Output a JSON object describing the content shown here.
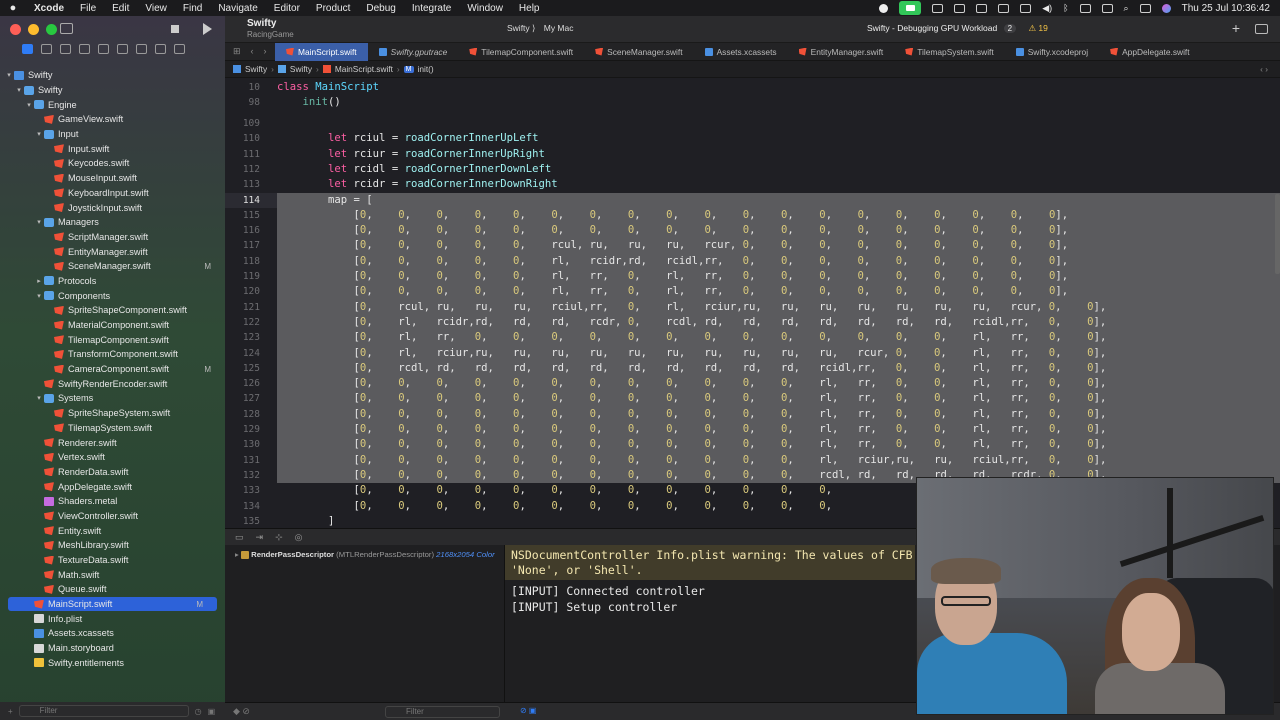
{
  "menubar": {
    "app": "Xcode",
    "items": [
      "File",
      "Edit",
      "View",
      "Find",
      "Navigate",
      "Editor",
      "Product",
      "Debug",
      "Integrate",
      "Window",
      "Help"
    ],
    "datetime": "Thu 25 Jul  10:36:42"
  },
  "toolbar": {
    "project": "Swifty",
    "subtitle": "RacingGame",
    "scheme": "Swifty ⟩",
    "destination": "My Mac",
    "status": "Swifty - Debugging GPU Workload",
    "status_count": "2",
    "warnings": "⚠ 19"
  },
  "tabs": [
    {
      "label": "MainScript.swift",
      "active": true
    },
    {
      "label": "Swifty.gputrace",
      "italic": true
    },
    {
      "label": "TilemapComponent.swift"
    },
    {
      "label": "SceneManager.swift"
    },
    {
      "label": "Assets.xcassets"
    },
    {
      "label": "EntityManager.swift"
    },
    {
      "label": "TilemapSystem.swift"
    },
    {
      "label": "Swifty.xcodeproj"
    },
    {
      "label": "AppDelegate.swift"
    }
  ],
  "jumpbar": {
    "items": [
      "Swifty",
      "Swifty",
      "MainScript.swift",
      "init()"
    ]
  },
  "navigator": {
    "items": [
      {
        "label": "Swifty",
        "depth": 0,
        "icon": "asset",
        "disc": "▾"
      },
      {
        "label": "Swifty",
        "depth": 1,
        "icon": "folder",
        "disc": "▾"
      },
      {
        "label": "Engine",
        "depth": 2,
        "icon": "folder",
        "disc": "▾"
      },
      {
        "label": "GameView.swift",
        "depth": 3,
        "icon": "swift"
      },
      {
        "label": "Input",
        "depth": 3,
        "icon": "folder",
        "disc": "▾"
      },
      {
        "label": "Input.swift",
        "depth": 4,
        "icon": "swift"
      },
      {
        "label": "Keycodes.swift",
        "depth": 4,
        "icon": "swift"
      },
      {
        "label": "MouseInput.swift",
        "depth": 4,
        "icon": "swift"
      },
      {
        "label": "KeyboardInput.swift",
        "depth": 4,
        "icon": "swift"
      },
      {
        "label": "JoystickInput.swift",
        "depth": 4,
        "icon": "swift"
      },
      {
        "label": "Managers",
        "depth": 3,
        "icon": "folder",
        "disc": "▾"
      },
      {
        "label": "ScriptManager.swift",
        "depth": 4,
        "icon": "swift"
      },
      {
        "label": "EntityManager.swift",
        "depth": 4,
        "icon": "swift"
      },
      {
        "label": "SceneManager.swift",
        "depth": 4,
        "icon": "swift",
        "badge": "M"
      },
      {
        "label": "Protocols",
        "depth": 3,
        "icon": "folder",
        "disc": "▸"
      },
      {
        "label": "Components",
        "depth": 3,
        "icon": "folder",
        "disc": "▾"
      },
      {
        "label": "SpriteShapeComponent.swift",
        "depth": 4,
        "icon": "swift"
      },
      {
        "label": "MaterialComponent.swift",
        "depth": 4,
        "icon": "swift"
      },
      {
        "label": "TilemapComponent.swift",
        "depth": 4,
        "icon": "swift"
      },
      {
        "label": "TransformComponent.swift",
        "depth": 4,
        "icon": "swift"
      },
      {
        "label": "CameraComponent.swift",
        "depth": 4,
        "icon": "swift",
        "badge": "M"
      },
      {
        "label": "SwiftyRenderEncoder.swift",
        "depth": 3,
        "icon": "swift"
      },
      {
        "label": "Systems",
        "depth": 3,
        "icon": "folder",
        "disc": "▾"
      },
      {
        "label": "SpriteShapeSystem.swift",
        "depth": 4,
        "icon": "swift"
      },
      {
        "label": "TilemapSystem.swift",
        "depth": 4,
        "icon": "swift"
      },
      {
        "label": "Renderer.swift",
        "depth": 3,
        "icon": "swift"
      },
      {
        "label": "Vertex.swift",
        "depth": 3,
        "icon": "swift"
      },
      {
        "label": "RenderData.swift",
        "depth": 3,
        "icon": "swift"
      },
      {
        "label": "AppDelegate.swift",
        "depth": 3,
        "icon": "swift"
      },
      {
        "label": "Shaders.metal",
        "depth": 3,
        "icon": "metal"
      },
      {
        "label": "ViewController.swift",
        "depth": 3,
        "icon": "swift"
      },
      {
        "label": "Entity.swift",
        "depth": 3,
        "icon": "swift"
      },
      {
        "label": "MeshLibrary.swift",
        "depth": 3,
        "icon": "swift"
      },
      {
        "label": "TextureData.swift",
        "depth": 3,
        "icon": "swift"
      },
      {
        "label": "Math.swift",
        "depth": 3,
        "icon": "swift"
      },
      {
        "label": "Queue.swift",
        "depth": 3,
        "icon": "swift"
      },
      {
        "label": "MainScript.swift",
        "depth": 2,
        "icon": "swift",
        "badge": "M",
        "selected": true
      },
      {
        "label": "Info.plist",
        "depth": 2,
        "icon": "file"
      },
      {
        "label": "Assets.xcassets",
        "depth": 2,
        "icon": "asset"
      },
      {
        "label": "Main.storyboard",
        "depth": 2,
        "icon": "file"
      },
      {
        "label": "Swifty.entitlements",
        "depth": 2,
        "icon": "plist"
      }
    ],
    "filter_placeholder": "Filter"
  },
  "editor": {
    "sticky": [
      {
        "n": "10",
        "code": "<span class='kw'>class</span> <span class='cls'>MainScript</span>"
      },
      {
        "n": "98",
        "code": "    <span class='fn'>init</span>()"
      }
    ],
    "lines": [
      {
        "n": "109",
        "code": ""
      },
      {
        "n": "110",
        "code": "        <span class='kw'>let</span> rciul = <span class='val'>roadCornerInnerUpLeft</span>"
      },
      {
        "n": "111",
        "code": "        <span class='kw'>let</span> rciur = <span class='val'>roadCornerInnerUpRight</span>"
      },
      {
        "n": "112",
        "code": "        <span class='kw'>let</span> rcidl = <span class='val'>roadCornerInnerDownLeft</span>"
      },
      {
        "n": "113",
        "code": "        <span class='kw'>let</span> rcidr = <span class='val'>roadCornerInnerDownRight</span>"
      },
      {
        "n": "114",
        "code": "        map = [",
        "cur": true
      },
      {
        "n": "115",
        "code": "            [<span class='num'>0</span>,    <span class='num'>0</span>,    <span class='num'>0</span>,    <span class='num'>0</span>,    <span class='num'>0</span>,    <span class='num'>0</span>,    <span class='num'>0</span>,    <span class='num'>0</span>,    <span class='num'>0</span>,    <span class='num'>0</span>,    <span class='num'>0</span>,    <span class='num'>0</span>,    <span class='num'>0</span>,    <span class='num'>0</span>,    <span class='num'>0</span>,    <span class='num'>0</span>,    <span class='num'>0</span>,    <span class='num'>0</span>,    <span class='num'>0</span>],"
      },
      {
        "n": "116",
        "code": "            [<span class='num'>0</span>,    <span class='num'>0</span>,    <span class='num'>0</span>,    <span class='num'>0</span>,    <span class='num'>0</span>,    <span class='num'>0</span>,    <span class='num'>0</span>,    <span class='num'>0</span>,    <span class='num'>0</span>,    <span class='num'>0</span>,    <span class='num'>0</span>,    <span class='num'>0</span>,    <span class='num'>0</span>,    <span class='num'>0</span>,    <span class='num'>0</span>,    <span class='num'>0</span>,    <span class='num'>0</span>,    <span class='num'>0</span>,    <span class='num'>0</span>],"
      },
      {
        "n": "117",
        "code": "            [<span class='num'>0</span>,    <span class='num'>0</span>,    <span class='num'>0</span>,    <span class='num'>0</span>,    <span class='num'>0</span>,    rcul, ru,   ru,   ru,   rcur, <span class='num'>0</span>,    <span class='num'>0</span>,    <span class='num'>0</span>,    <span class='num'>0</span>,    <span class='num'>0</span>,    <span class='num'>0</span>,    <span class='num'>0</span>,    <span class='num'>0</span>,    <span class='num'>0</span>],"
      },
      {
        "n": "118",
        "code": "            [<span class='num'>0</span>,    <span class='num'>0</span>,    <span class='num'>0</span>,    <span class='num'>0</span>,    <span class='num'>0</span>,    rl,   rcidr,rd,   rcidl,rr,   <span class='num'>0</span>,    <span class='num'>0</span>,    <span class='num'>0</span>,    <span class='num'>0</span>,    <span class='num'>0</span>,    <span class='num'>0</span>,    <span class='num'>0</span>,    <span class='num'>0</span>,    <span class='num'>0</span>],"
      },
      {
        "n": "119",
        "code": "            [<span class='num'>0</span>,    <span class='num'>0</span>,    <span class='num'>0</span>,    <span class='num'>0</span>,    <span class='num'>0</span>,    rl,   rr,   <span class='num'>0</span>,    rl,   rr,   <span class='num'>0</span>,    <span class='num'>0</span>,    <span class='num'>0</span>,    <span class='num'>0</span>,    <span class='num'>0</span>,    <span class='num'>0</span>,    <span class='num'>0</span>,    <span class='num'>0</span>,    <span class='num'>0</span>],"
      },
      {
        "n": "120",
        "code": "            [<span class='num'>0</span>,    <span class='num'>0</span>,    <span class='num'>0</span>,    <span class='num'>0</span>,    <span class='num'>0</span>,    rl,   rr,   <span class='num'>0</span>,    rl,   rr,   <span class='num'>0</span>,    <span class='num'>0</span>,    <span class='num'>0</span>,    <span class='num'>0</span>,    <span class='num'>0</span>,    <span class='num'>0</span>,    <span class='num'>0</span>,    <span class='num'>0</span>,    <span class='num'>0</span>],"
      },
      {
        "n": "121",
        "code": "            [<span class='num'>0</span>,    rcul, ru,   ru,   ru,   rciul,rr,   <span class='num'>0</span>,    rl,   rciur,ru,   ru,   ru,   ru,   ru,   ru,   ru,   rcur, <span class='num'>0</span>,    <span class='num'>0</span>],"
      },
      {
        "n": "122",
        "code": "            [<span class='num'>0</span>,    rl,   rcidr,rd,   rd,   rd,   rcdr, <span class='num'>0</span>,    rcdl, rd,   rd,   rd,   rd,   rd,   rd,   rd,   rcidl,rr,   <span class='num'>0</span>,    <span class='num'>0</span>],"
      },
      {
        "n": "123",
        "code": "            [<span class='num'>0</span>,    rl,   rr,   <span class='num'>0</span>,    <span class='num'>0</span>,    <span class='num'>0</span>,    <span class='num'>0</span>,    <span class='num'>0</span>,    <span class='num'>0</span>,    <span class='num'>0</span>,    <span class='num'>0</span>,    <span class='num'>0</span>,    <span class='num'>0</span>,    <span class='num'>0</span>,    <span class='num'>0</span>,    <span class='num'>0</span>,    rl,   rr,   <span class='num'>0</span>,    <span class='num'>0</span>],"
      },
      {
        "n": "124",
        "code": "            [<span class='num'>0</span>,    rl,   rciur,ru,   ru,   ru,   ru,   ru,   ru,   ru,   ru,   ru,   ru,   rcur, <span class='num'>0</span>,    <span class='num'>0</span>,    rl,   rr,   <span class='num'>0</span>,    <span class='num'>0</span>],"
      },
      {
        "n": "125",
        "code": "            [<span class='num'>0</span>,    rcdl, rd,   rd,   rd,   rd,   rd,   rd,   rd,   rd,   rd,   rd,   rcidl,rr,   <span class='num'>0</span>,    <span class='num'>0</span>,    rl,   rr,   <span class='num'>0</span>,    <span class='num'>0</span>],"
      },
      {
        "n": "126",
        "code": "            [<span class='num'>0</span>,    <span class='num'>0</span>,    <span class='num'>0</span>,    <span class='num'>0</span>,    <span class='num'>0</span>,    <span class='num'>0</span>,    <span class='num'>0</span>,    <span class='num'>0</span>,    <span class='num'>0</span>,    <span class='num'>0</span>,    <span class='num'>0</span>,    <span class='num'>0</span>,    rl,   rr,   <span class='num'>0</span>,    <span class='num'>0</span>,    rl,   rr,   <span class='num'>0</span>,    <span class='num'>0</span>],"
      },
      {
        "n": "127",
        "code": "            [<span class='num'>0</span>,    <span class='num'>0</span>,    <span class='num'>0</span>,    <span class='num'>0</span>,    <span class='num'>0</span>,    <span class='num'>0</span>,    <span class='num'>0</span>,    <span class='num'>0</span>,    <span class='num'>0</span>,    <span class='num'>0</span>,    <span class='num'>0</span>,    <span class='num'>0</span>,    rl,   rr,   <span class='num'>0</span>,    <span class='num'>0</span>,    rl,   rr,   <span class='num'>0</span>,    <span class='num'>0</span>],"
      },
      {
        "n": "128",
        "code": "            [<span class='num'>0</span>,    <span class='num'>0</span>,    <span class='num'>0</span>,    <span class='num'>0</span>,    <span class='num'>0</span>,    <span class='num'>0</span>,    <span class='num'>0</span>,    <span class='num'>0</span>,    <span class='num'>0</span>,    <span class='num'>0</span>,    <span class='num'>0</span>,    <span class='num'>0</span>,    rl,   rr,   <span class='num'>0</span>,    <span class='num'>0</span>,    rl,   rr,   <span class='num'>0</span>,    <span class='num'>0</span>],"
      },
      {
        "n": "129",
        "code": "            [<span class='num'>0</span>,    <span class='num'>0</span>,    <span class='num'>0</span>,    <span class='num'>0</span>,    <span class='num'>0</span>,    <span class='num'>0</span>,    <span class='num'>0</span>,    <span class='num'>0</span>,    <span class='num'>0</span>,    <span class='num'>0</span>,    <span class='num'>0</span>,    <span class='num'>0</span>,    rl,   rr,   <span class='num'>0</span>,    <span class='num'>0</span>,    rl,   rr,   <span class='num'>0</span>,    <span class='num'>0</span>],"
      },
      {
        "n": "130",
        "code": "            [<span class='num'>0</span>,    <span class='num'>0</span>,    <span class='num'>0</span>,    <span class='num'>0</span>,    <span class='num'>0</span>,    <span class='num'>0</span>,    <span class='num'>0</span>,    <span class='num'>0</span>,    <span class='num'>0</span>,    <span class='num'>0</span>,    <span class='num'>0</span>,    <span class='num'>0</span>,    rl,   rr,   <span class='num'>0</span>,    <span class='num'>0</span>,    rl,   rr,   <span class='num'>0</span>,    <span class='num'>0</span>],"
      },
      {
        "n": "131",
        "code": "            [<span class='num'>0</span>,    <span class='num'>0</span>,    <span class='num'>0</span>,    <span class='num'>0</span>,    <span class='num'>0</span>,    <span class='num'>0</span>,    <span class='num'>0</span>,    <span class='num'>0</span>,    <span class='num'>0</span>,    <span class='num'>0</span>,    <span class='num'>0</span>,    <span class='num'>0</span>,    rl,   rciur,ru,   ru,   rciul,rr,   <span class='num'>0</span>,    <span class='num'>0</span>],"
      },
      {
        "n": "132",
        "code": "            [<span class='num'>0</span>,    <span class='num'>0</span>,    <span class='num'>0</span>,    <span class='num'>0</span>,    <span class='num'>0</span>,    <span class='num'>0</span>,    <span class='num'>0</span>,    <span class='num'>0</span>,    <span class='num'>0</span>,    <span class='num'>0</span>,    <span class='num'>0</span>,    <span class='num'>0</span>,    rcdl, rd,   rd,   rd,   rd,   rcdr, <span class='num'>0</span>,    <span class='num'>0</span>],"
      },
      {
        "n": "133",
        "code": "            [<span class='num'>0</span>,    <span class='num'>0</span>,    <span class='num'>0</span>,    <span class='num'>0</span>,    <span class='num'>0</span>,    <span class='num'>0</span>,    <span class='num'>0</span>,    <span class='num'>0</span>,    <span class='num'>0</span>,    <span class='num'>0</span>,    <span class='num'>0</span>,    <span class='num'>0</span>,    <span class='num'>0</span>,"
      },
      {
        "n": "134",
        "code": "            [<span class='num'>0</span>,    <span class='num'>0</span>,    <span class='num'>0</span>,    <span class='num'>0</span>,    <span class='num'>0</span>,    <span class='num'>0</span>,    <span class='num'>0</span>,    <span class='num'>0</span>,    <span class='num'>0</span>,    <span class='num'>0</span>,    <span class='num'>0</span>,    <span class='num'>0</span>,    <span class='num'>0</span>,"
      },
      {
        "n": "135",
        "code": "        ]"
      }
    ]
  },
  "variables": {
    "name": "RenderPassDescriptor",
    "type": "(MTLRenderPassDescriptor)",
    "detail": "2168x2054 Color"
  },
  "console": {
    "warning": "NSDocumentController Info.plist warning: The values of CFB\n'None', or 'Shell'.",
    "lines": [
      "[INPUT] Connected controller",
      "[INPUT] Setup controller"
    ],
    "filter_placeholder": "Filter"
  }
}
